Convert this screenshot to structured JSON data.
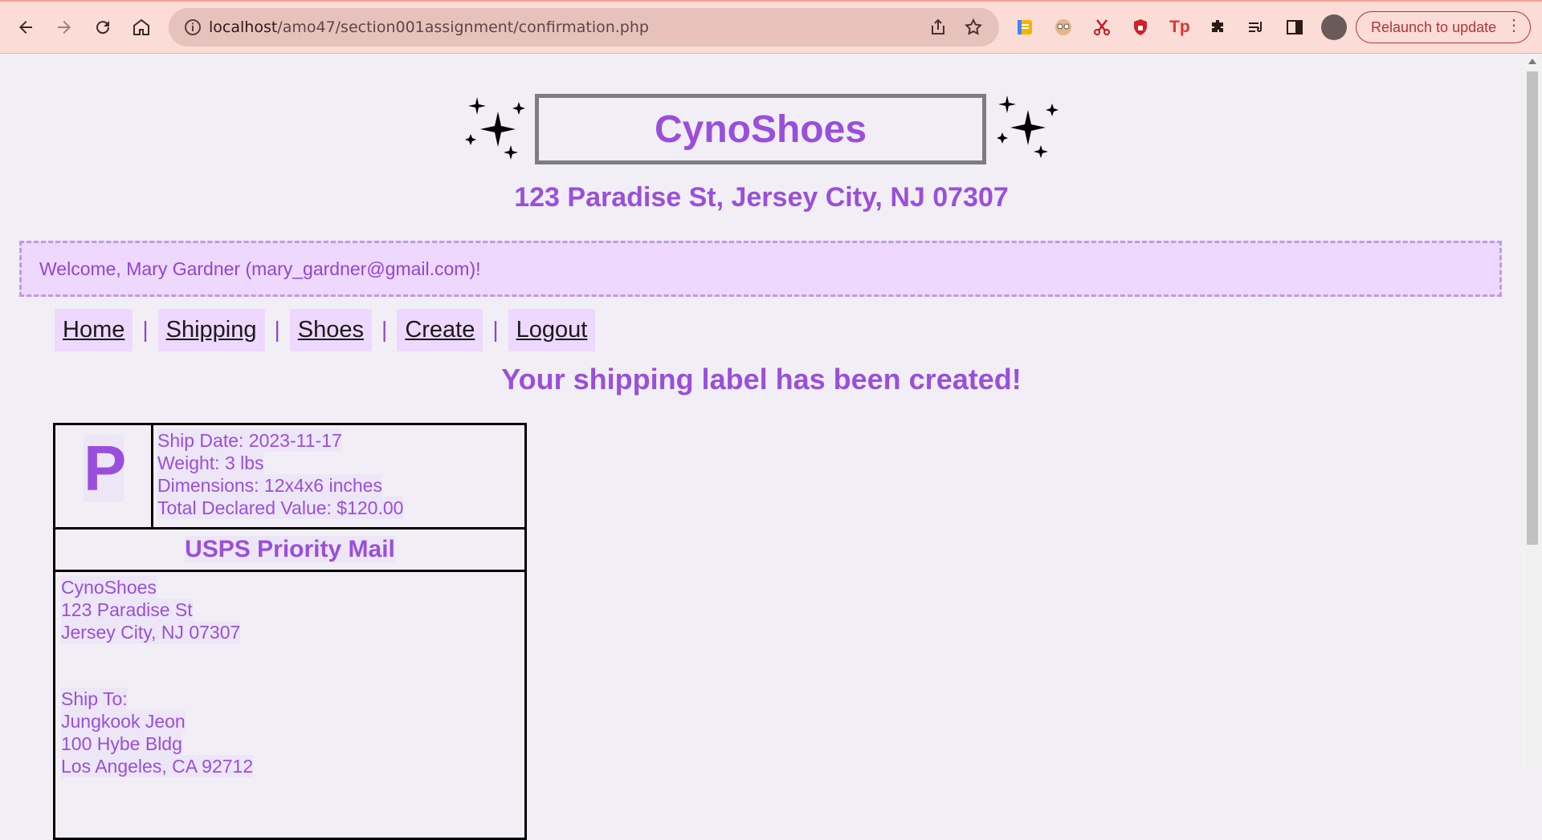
{
  "browser": {
    "url_host": "localhost",
    "url_path": "/amo47/section001assignment/confirmation.php",
    "relaunch_label": "Relaunch to update"
  },
  "site": {
    "brand": "CynoShoes",
    "address": "123 Paradise St, Jersey City, NJ 07307",
    "welcome": "Welcome, Mary Gardner (mary_gardner@gmail.com)!"
  },
  "nav": {
    "items": [
      "Home",
      "Shipping",
      "Shoes",
      "Create",
      "Logout"
    ],
    "separator": "|"
  },
  "confirmation": {
    "title": "Your shipping label has been created!"
  },
  "label": {
    "service_letter": "P",
    "ship_date": "Ship Date: 2023-11-17",
    "weight": "Weight: 3 lbs",
    "dimensions": "Dimensions: 12x4x6 inches",
    "declared_value": "Total Declared Value: $120.00",
    "service_name": "USPS Priority Mail",
    "from": {
      "name": "CynoShoes",
      "street": "123 Paradise St",
      "city": "Jersey City, NJ 07307"
    },
    "to": {
      "heading": "Ship To:",
      "name": "Jungkook Jeon",
      "street": "100 Hybe Bldg",
      "city": "Los Angeles, CA 92712"
    }
  },
  "colors": {
    "accent": "#9a4fdc",
    "chrome": "#fbdcd6",
    "welcome_bg": "#eed8fd"
  }
}
